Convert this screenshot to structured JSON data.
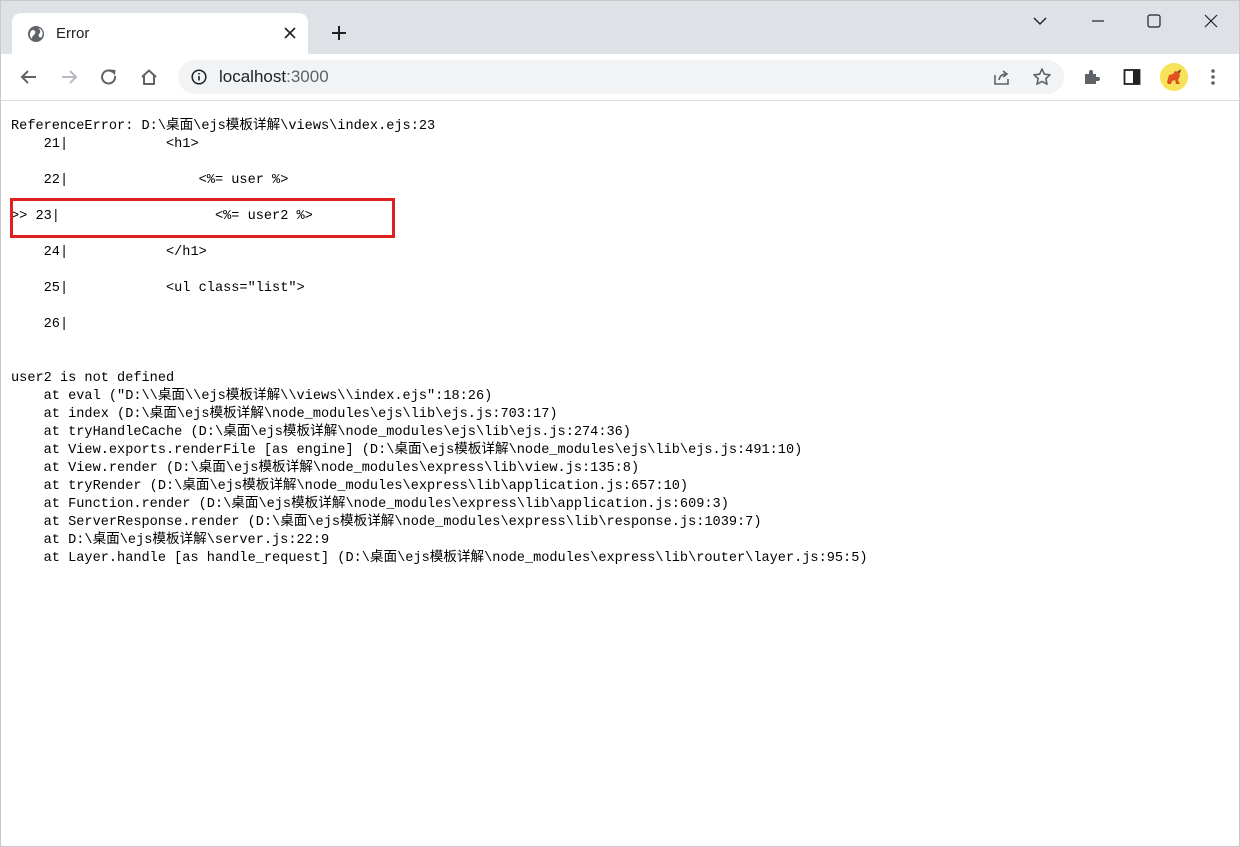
{
  "tab": {
    "title": "Error",
    "favicon_icon": "globe-icon",
    "close_icon": "close-icon"
  },
  "tabstrip": {
    "new_tab_icon": "plus-icon",
    "controls": [
      "chevron-down-icon",
      "minimize-icon",
      "maximize-icon",
      "close-icon"
    ]
  },
  "toolbar": {
    "nav_icons": [
      "back-icon",
      "forward-icon",
      "reload-icon",
      "home-icon"
    ],
    "url_host": "localhost",
    "url_port": ":3000",
    "site_info_icon": "info-icon",
    "omnibox_icons": [
      "share-icon",
      "star-icon"
    ],
    "right_icons": [
      "extensions-icon",
      "side-panel-icon",
      "profile-avatar",
      "menu-icon"
    ]
  },
  "page": {
    "error_text": "ReferenceError: D:\\桌面\\ejs模板详解\\views\\index.ejs:23\n    21|            <h1>\n\n    22|                <%= user %>\n\n>> 23|                   <%= user2 %>\n\n    24|            </h1>\n\n    25|            <ul class=\"list\">\n\n    26|\n\n\nuser2 is not defined\n    at eval (\"D:\\\\桌面\\\\ejs模板详解\\\\views\\\\index.ejs\":18:26)\n    at index (D:\\桌面\\ejs模板详解\\node_modules\\ejs\\lib\\ejs.js:703:17)\n    at tryHandleCache (D:\\桌面\\ejs模板详解\\node_modules\\ejs\\lib\\ejs.js:274:36)\n    at View.exports.renderFile [as engine] (D:\\桌面\\ejs模板详解\\node_modules\\ejs\\lib\\ejs.js:491:10)\n    at View.render (D:\\桌面\\ejs模板详解\\node_modules\\express\\lib\\view.js:135:8)\n    at tryRender (D:\\桌面\\ejs模板详解\\node_modules\\express\\lib\\application.js:657:10)\n    at Function.render (D:\\桌面\\ejs模板详解\\node_modules\\express\\lib\\application.js:609:3)\n    at ServerResponse.render (D:\\桌面\\ejs模板详解\\node_modules\\express\\lib\\response.js:1039:7)\n    at D:\\桌面\\ejs模板详解\\server.js:22:9\n    at Layer.handle [as handle_request] (D:\\桌面\\ejs模板详解\\node_modules\\express\\lib\\router\\layer.js:95:5)",
    "highlight_color": "#e02020"
  },
  "colors": {
    "tabstrip_bg": "#dee1e6",
    "omnibox_bg": "#f1f3f4",
    "icon": "#5f6368",
    "text": "#202124"
  }
}
